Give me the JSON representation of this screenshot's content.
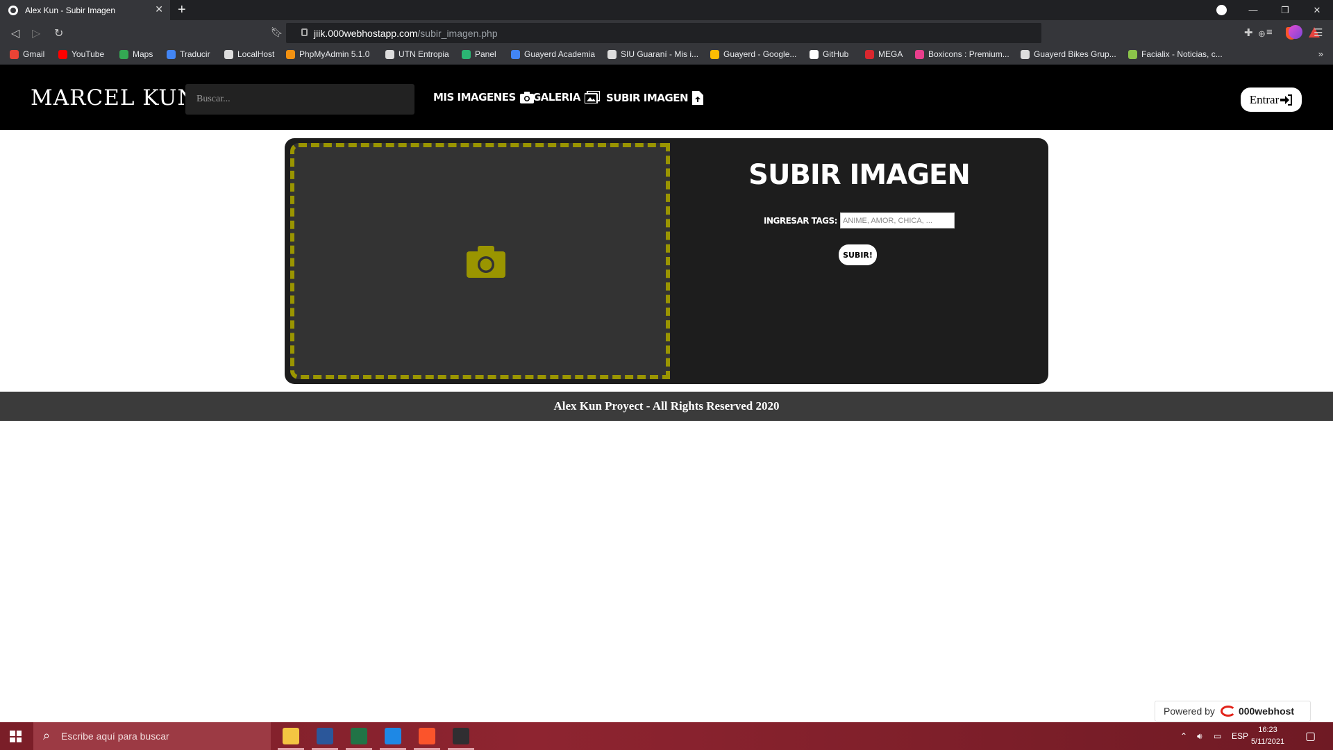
{
  "browser": {
    "tab_title": "Alex Kun - Subir Imagen",
    "tab_close": "✕",
    "new_tab": "+",
    "url_host": "jiik.000webhostapp.com",
    "url_path": "/subir_imagen.php",
    "window_controls": [
      "—",
      "❐",
      "✕"
    ],
    "bookmarks": [
      {
        "label": "Gmail",
        "color": "#ea4335"
      },
      {
        "label": "YouTube",
        "color": "#ff0000"
      },
      {
        "label": "Maps",
        "color": "#34a853"
      },
      {
        "label": "Traducir",
        "color": "#4285f4"
      },
      {
        "label": "LocalHost",
        "color": "#dddddd"
      },
      {
        "label": "PhpMyAdmin 5.1.0",
        "color": "#f29111"
      },
      {
        "label": "UTN Entropia",
        "color": "#dddddd"
      },
      {
        "label": "Panel",
        "color": "#2bb673"
      },
      {
        "label": "Guayerd Academia",
        "color": "#4285f4"
      },
      {
        "label": "SIU Guaraní - Mis i...",
        "color": "#dddddd"
      },
      {
        "label": "Guayerd - Google...",
        "color": "#fbbc04"
      },
      {
        "label": "GitHub",
        "color": "#ffffff"
      },
      {
        "label": "MEGA",
        "color": "#d9272e"
      },
      {
        "label": "Boxicons : Premium...",
        "color": "#e83e8c"
      },
      {
        "label": "Guayerd Bikes Grup...",
        "color": "#dddddd"
      },
      {
        "label": "Facialix - Noticias, c...",
        "color": "#8bc34a"
      }
    ],
    "bookmarks_more": "»"
  },
  "site": {
    "logo": "MARCEL KUN",
    "search_placeholder": "Buscar...",
    "nav": {
      "mis_imagenes": "MIS IMAGENES",
      "galeria": "GALERIA",
      "subir_imagen": "SUBIR IMAGEN"
    },
    "login_label": "Entrar",
    "upload": {
      "title": "SUBIR IMAGEN",
      "tags_label": "INGRESAR TAGS:",
      "tags_placeholder": "ANIME, AMOR, CHICA, ...",
      "submit_label": "SUBIR!"
    },
    "footer": "Alex Kun Proyect - All Rights Reserved 2020",
    "powered_by": "Powered by",
    "powered_brand": "000webhost"
  },
  "taskbar": {
    "search_placeholder": "Escribe aquí para buscar",
    "apps": [
      {
        "name": "file-explorer-icon",
        "color": "#f4c542"
      },
      {
        "name": "word-icon",
        "color": "#2b579a"
      },
      {
        "name": "excel-icon",
        "color": "#217346"
      },
      {
        "name": "vscode-icon",
        "color": "#1e88e5"
      },
      {
        "name": "brave-icon",
        "color": "#fb542b"
      },
      {
        "name": "obs-icon",
        "color": "#302e31"
      }
    ],
    "language": "ESP",
    "time": "16:23",
    "date": "5/11/2021"
  },
  "colors": {
    "dropzone_border": "#9a9500",
    "dropzone_bg": "#333333",
    "card_bg": "#1d1d1d",
    "header_bg": "#000000",
    "footer_bg": "#3b3b3b"
  }
}
